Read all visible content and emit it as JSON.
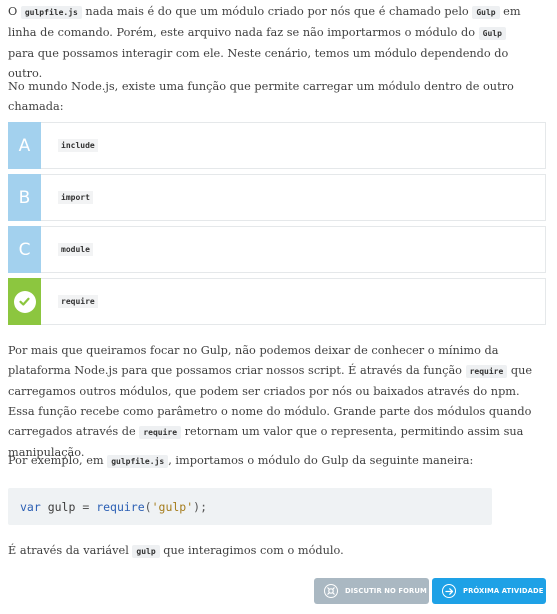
{
  "intro": {
    "pre": "O ",
    "code1": "gulpfile.js",
    "mid1": " nada mais é do que um módulo criado por nós que é chamado pelo ",
    "code2": "Gulp",
    "mid2": " em linha de comando. Porém, este arquivo nada faz se não importarmos o módulo do ",
    "code3": "Gulp",
    "end": " para que possamos interagir com ele. Neste cenário, temos um módulo dependendo do outro."
  },
  "question": "No mundo Node.js, existe uma função que permite carregar um módulo dentro de outro chamada:",
  "options": [
    {
      "letter": "A",
      "label": "include"
    },
    {
      "letter": "B",
      "label": "import"
    },
    {
      "letter": "C",
      "label": "module"
    },
    {
      "letter": "",
      "label": "require",
      "correct": true
    }
  ],
  "explanation": {
    "t1": "Por mais que queiramos focar no Gulp, não podemos deixar de conhecer o mínimo da plataforma Node.js para que possamos criar nossos script. É através da função ",
    "code1": "require",
    "t2": " que carregamos outros módulos, que podem ser criados por nós ou baixados através do npm. Essa função recebe como parâmetro o nome do módulo. Grande parte dos módulos quando carregados através de ",
    "code2": "require",
    "t3": " retornam um valor que o representa, permitindo assim sua manipulação."
  },
  "example": {
    "pre": "Por exemplo, em ",
    "code": "gulpfile.js",
    "post": ", importamos o módulo do Gulp da seguinte maneira:"
  },
  "codeblock": {
    "kw": "var",
    "name": " gulp ",
    "eq": "=",
    "fn": " require",
    "open": "(",
    "str": "'gulp'",
    "close": ");"
  },
  "closing": {
    "pre": "É através da variável ",
    "code": "gulp",
    "post": " que interagimos com o módulo."
  },
  "buttons": {
    "forum": "DISCUTIR NO FORUM",
    "next": "PRÓXIMA ATIVIDADE"
  },
  "colors": {
    "option_letter": "#a3d1ee",
    "correct": "#8cc63f",
    "forum_button": "#aab8c2",
    "next_button": "#1ea1e6"
  }
}
